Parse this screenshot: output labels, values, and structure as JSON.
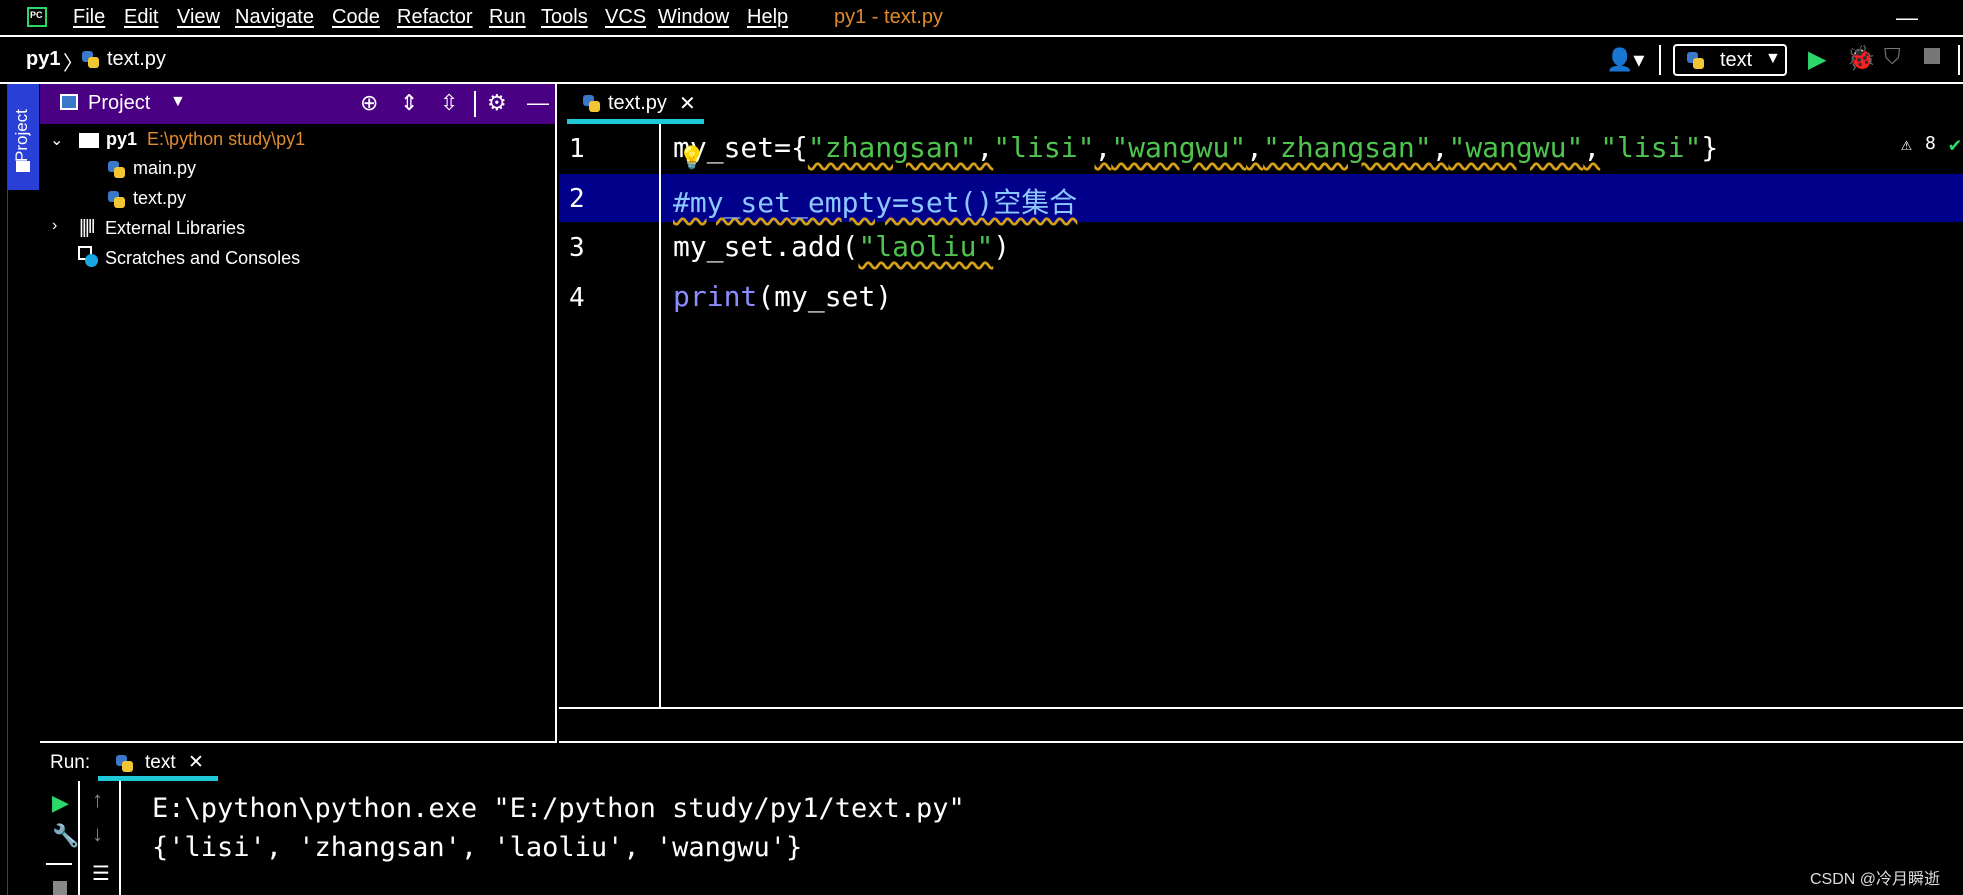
{
  "menu": {
    "items": [
      "File",
      "Edit",
      "View",
      "Navigate",
      "Code",
      "Refactor",
      "Run",
      "Tools",
      "VCS",
      "Window",
      "Help"
    ],
    "window_title": "py1 - text.py",
    "logo_text": "PC"
  },
  "breadcrumb": {
    "project": "py1",
    "separator": "〉",
    "file": "text.py"
  },
  "toolbar": {
    "run_config": "text"
  },
  "side_stripe": {
    "project_label": "Project"
  },
  "project_panel": {
    "title": "Project",
    "tree": {
      "root_name": "py1",
      "root_path": "E:\\python study\\py1",
      "files": [
        "main.py",
        "text.py"
      ],
      "external_libraries": "External Libraries",
      "scratches": "Scratches and Consoles"
    }
  },
  "editor": {
    "tab_label": "text.py",
    "line_numbers": [
      "1",
      "2",
      "3",
      "4"
    ],
    "lines": {
      "l1": {
        "var": "my_set={",
        "s1": "\"zhangsan\"",
        "c": ",",
        "s2": "\"lisi\"",
        "s3": "\"wangwu\"",
        "s4": "\"zhangsan\"",
        "s5": "\"wangwu\"",
        "s6": "\"lisi\"",
        "end": "}"
      },
      "l2": "#my_set_empty=set()空集合",
      "l3": {
        "pre": "my_set.add(",
        "str": "\"laoliu\"",
        "post": ")"
      },
      "l4": {
        "kw": "print",
        "post": "(my_set)"
      }
    },
    "warning_count": "8"
  },
  "run_panel": {
    "label": "Run:",
    "tab_label": "text",
    "console": [
      "E:\\python\\python.exe \"E:/python study/py1/text.py\"",
      "{'lisi', 'zhangsan', 'laoliu', 'wangwu'}"
    ]
  },
  "watermark": "CSDN @冷月瞬逝",
  "colors": {
    "accent": "#1fc8d8",
    "header": "#4a0082",
    "selection": "#00008b",
    "string": "#4ec44e",
    "keyword": "#8c8cff",
    "title": "#e08a2c",
    "run": "#2bd86a"
  }
}
